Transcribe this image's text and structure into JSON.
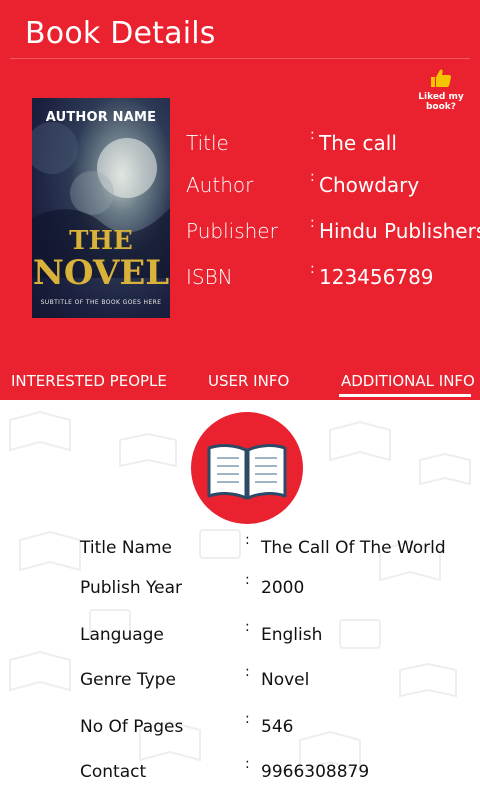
{
  "header": {
    "title": "Book Details",
    "liked_label": "Liked my book?"
  },
  "cover": {
    "author": "AUTHOR NAME",
    "title_line1": "THE",
    "title_line2": "NOVEL",
    "subtitle": "SUBTITLE OF THE BOOK GOES HERE"
  },
  "details": [
    {
      "label": "Title",
      "value": "The call"
    },
    {
      "label": "Author",
      "value": "Chowdary"
    },
    {
      "label": "Publisher",
      "value": "Hindu Publishers"
    },
    {
      "label": "ISBN",
      "value": "123456789"
    }
  ],
  "colon": ":",
  "tabs": [
    {
      "label": "INTERESTED PEOPLE",
      "active": false
    },
    {
      "label": "USER INFO",
      "active": false
    },
    {
      "label": "ADDITIONAL INFO",
      "active": true
    }
  ],
  "additional": [
    {
      "label": "Title Name",
      "value": "The Call Of The World"
    },
    {
      "label": "Publish Year",
      "value": "2000"
    },
    {
      "label": "Language",
      "value": "English"
    },
    {
      "label": "Genre Type",
      "value": "Novel"
    },
    {
      "label": "No Of Pages",
      "value": "546"
    },
    {
      "label": "Contact",
      "value": "9966308879"
    }
  ],
  "colors": {
    "accent": "#ea212e",
    "like_icon": "#f5c400"
  }
}
